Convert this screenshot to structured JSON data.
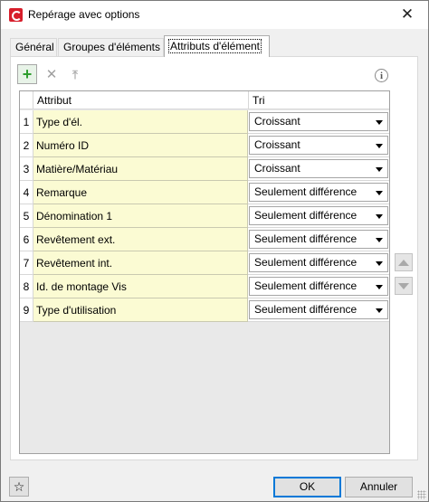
{
  "window": {
    "title": "Repérage avec options",
    "close_glyph": "✕"
  },
  "tabs": [
    {
      "label": "Général"
    },
    {
      "label": "Groupes d'éléments"
    },
    {
      "label": "Attributs d'élément",
      "active": true
    }
  ],
  "toolbar": {
    "add_icon": "add-row-icon",
    "delete_icon": "delete-row-icon",
    "move_top_icon": "move-to-top-icon",
    "info_icon": "info-icon",
    "info_glyph": "i"
  },
  "grid": {
    "headers": {
      "attribute": "Attribut",
      "sort": "Tri"
    },
    "rows": [
      {
        "num": "1",
        "attribute": "Type d'él.",
        "sort": "Croissant"
      },
      {
        "num": "2",
        "attribute": "Numéro ID",
        "sort": "Croissant"
      },
      {
        "num": "3",
        "attribute": "Matière/Matériau",
        "sort": "Croissant"
      },
      {
        "num": "4",
        "attribute": "Remarque",
        "sort": "Seulement différence"
      },
      {
        "num": "5",
        "attribute": "Dénomination 1",
        "sort": "Seulement différence"
      },
      {
        "num": "6",
        "attribute": "Revêtement ext.",
        "sort": "Seulement différence"
      },
      {
        "num": "7",
        "attribute": "Revêtement int.",
        "sort": "Seulement différence"
      },
      {
        "num": "8",
        "attribute": "Id. de montage Vis",
        "sort": "Seulement différence"
      },
      {
        "num": "9",
        "attribute": "Type d'utilisation",
        "sort": "Seulement différence"
      }
    ]
  },
  "buttons": {
    "ok": "OK",
    "cancel": "Annuler",
    "favorite_glyph": "☆"
  },
  "colors": {
    "attribute_cell_bg": "#fbfbd3",
    "add_icon": "#2f9e2f",
    "app_icon": "#d71e2b",
    "default_button_border": "#0078d7"
  }
}
